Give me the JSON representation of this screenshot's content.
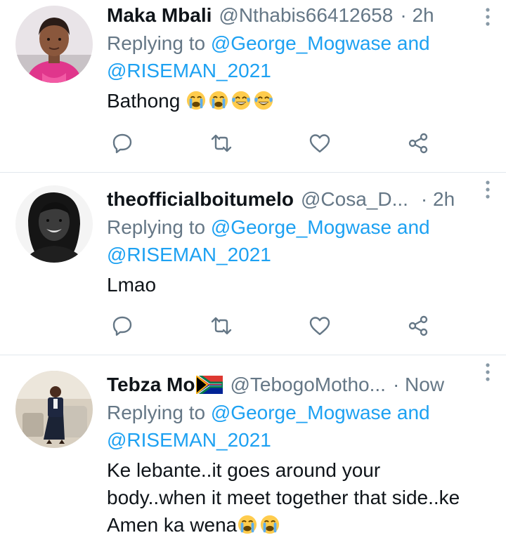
{
  "tweets": [
    {
      "name": "Maka Mbali",
      "handle": "@Nthabis66412658",
      "time": "· 2h",
      "reply_prefix": "Replying to",
      "reply_to_1": "@George_Mogwase",
      "reply_and": "and",
      "reply_to_2": "@RISEMAN_2021",
      "text": "Bathong",
      "emojis": [
        "loudly-crying-face",
        "loudly-crying-face",
        "face-with-tears-of-joy",
        "face-with-tears-of-joy"
      ]
    },
    {
      "name": "theofficialboitumelo",
      "handle": "@Cosa_D...",
      "time": "· 2h",
      "reply_prefix": "Replying to",
      "reply_to_1": "@George_Mogwase",
      "reply_and": "and",
      "reply_to_2": "@RISEMAN_2021",
      "text": "Lmao",
      "emojis": []
    },
    {
      "name": "Tebza Mo",
      "name_flag": "south-africa-flag",
      "handle": "@TebogoMotho...",
      "time": "· Now",
      "reply_prefix": "Replying to",
      "reply_to_1": "@George_Mogwase",
      "reply_and": "and",
      "reply_to_2": "@RISEMAN_2021",
      "text_line1": "Ke lebante..it goes around your",
      "text_line2": "body..when it meet together that side..ke",
      "text_line3": "Amen ka wena",
      "emojis": [
        "loudly-crying-face",
        "loudly-crying-face"
      ]
    }
  ],
  "actions": [
    "reply-icon",
    "retweet-icon",
    "like-icon",
    "share-icon"
  ],
  "colors": {
    "link": "#1da1f2",
    "secondary_text": "#657786",
    "primary_text": "#0f1419",
    "divider": "#e1e8ed"
  }
}
